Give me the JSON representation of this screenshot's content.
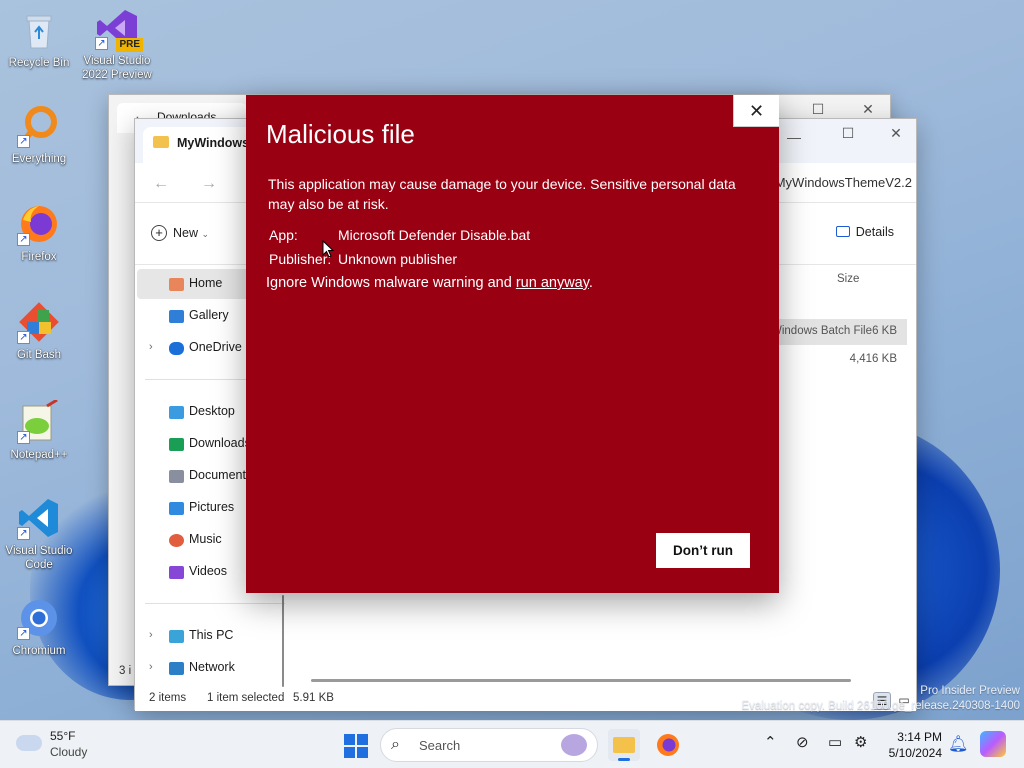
{
  "desktop": {
    "icons": [
      {
        "label": "Recycle Bin",
        "icon": "recycle-bin-icon"
      },
      {
        "label": "Visual Studio 2022 Preview",
        "icon": "visual-studio-icon",
        "badge": "PRE"
      },
      {
        "label": "Everything",
        "icon": "everything-search-icon"
      },
      {
        "label": "Firefox",
        "icon": "firefox-icon"
      },
      {
        "label": "Git Bash",
        "icon": "git-bash-icon"
      },
      {
        "label": "Notepad++",
        "icon": "notepad-plus-plus-icon"
      },
      {
        "label": "Visual Studio Code",
        "icon": "vscode-icon"
      },
      {
        "label": "Chromium",
        "icon": "chromium-icon"
      }
    ],
    "watermark": {
      "line1": "Pro Insider Preview",
      "line2": "Evaluation copy. Build 26100.ge_release.240308-1400"
    }
  },
  "explorer_back": {
    "tab_title": "Downloads",
    "status_items": "3 i"
  },
  "explorer": {
    "tab_title": "MyWindowsThemeV2.2",
    "address": "MyWindowsThemeV2.2",
    "new_label": "New",
    "details_label": "Details",
    "column_size": "Size",
    "sidebar": [
      {
        "label": "Home",
        "icon": "home-icon",
        "selected": true
      },
      {
        "label": "Gallery",
        "icon": "gallery-icon"
      },
      {
        "label": "OneDrive",
        "icon": "onedrive-icon",
        "expandable": true
      },
      {
        "label": "Desktop",
        "icon": "desktop-folder-icon"
      },
      {
        "label": "Downloads",
        "icon": "downloads-folder-icon"
      },
      {
        "label": "Documents",
        "icon": "documents-folder-icon"
      },
      {
        "label": "Pictures",
        "icon": "pictures-folder-icon"
      },
      {
        "label": "Music",
        "icon": "music-folder-icon"
      },
      {
        "label": "Videos",
        "icon": "videos-folder-icon"
      },
      {
        "label": "This PC",
        "icon": "this-pc-icon",
        "expandable": true
      },
      {
        "label": "Network",
        "icon": "network-icon",
        "expandable": true
      }
    ],
    "files": [
      {
        "type": "Windows Batch File",
        "size": "6 KB",
        "selected": true
      },
      {
        "type": "",
        "size": "4,416 KB",
        "selected": false
      }
    ],
    "status": {
      "items": "2 items",
      "selected": "1 item selected",
      "size": "5.91 KB"
    }
  },
  "dialog": {
    "title": "Malicious file",
    "message": "This application may cause damage to your device. Sensitive personal data may also be at risk.",
    "app_label": "App:",
    "app_value": "Microsoft Defender Disable.bat",
    "publisher_label": "Publisher:",
    "publisher_value": "Unknown publisher",
    "ignore_text": "Ignore Windows malware warning and ",
    "run_anyway": "run anyway",
    "ignore_end": ".",
    "dont_run": "Don’t run",
    "color": "#990012"
  },
  "taskbar": {
    "weather_temp": "55°F",
    "weather_desc": "Cloudy",
    "search_placeholder": "Search",
    "time": "3:14 PM",
    "date": "5/10/2024"
  }
}
